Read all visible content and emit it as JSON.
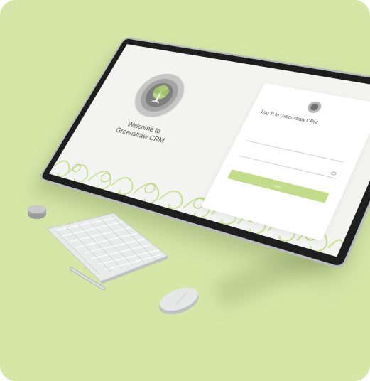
{
  "colors": {
    "background": "#d5e6a7",
    "accent": "#c2dc8c",
    "screen": "#f3f4f2"
  },
  "welcome": {
    "line1": "Welcome to",
    "line2": "Greenstraw CRM"
  },
  "login": {
    "title": "Log in to Greenstraw CRM",
    "subtitle": "",
    "email_label": "",
    "email_placeholder": "",
    "password_label": "",
    "password_placeholder": "",
    "forgot": "",
    "button_label": "Log in"
  },
  "icons": [
    "tree-logo-icon",
    "eye-icon"
  ]
}
